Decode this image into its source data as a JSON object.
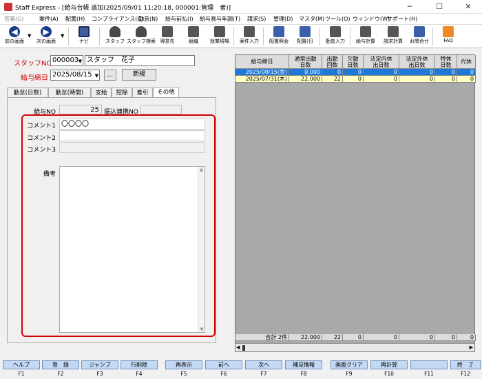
{
  "window": {
    "app_name": "Staff Express",
    "title": "Staff Express - [給与台帳 追加(2025/09/01 11:20:18, 000001:管理　者)]",
    "min": "─",
    "max": "☐",
    "close": "✕"
  },
  "menu": [
    "営業(G)",
    "案件(A)",
    "配置(H)",
    "コンプライアンス(C)",
    "勤怠(N)",
    "給与前払(I)",
    "給与賞与年調(T)",
    "請求(S)",
    "管理(D)",
    "マスタ(M)",
    "ツール(O)",
    "ウィンドウ(W)",
    "サポート(H)"
  ],
  "toolbar": [
    {
      "label": "前の画面",
      "icon": "arrow-left-icon"
    },
    {
      "label": "次の画面",
      "icon": "arrow-right-icon"
    },
    {
      "label": "ナビ",
      "icon": "monitor-icon"
    },
    {
      "label": "スタッフ",
      "icon": "staff-icon"
    },
    {
      "label": "スタッフ検索",
      "icon": "staff-search-icon"
    },
    {
      "label": "得意先",
      "icon": "client-icon"
    },
    {
      "label": "組織",
      "icon": "organization-icon"
    },
    {
      "label": "就業現場",
      "icon": "worksite-icon"
    },
    {
      "label": "案件入力",
      "icon": "case-entry-icon"
    },
    {
      "label": "配置照会",
      "icon": "assignment-inquiry-icon"
    },
    {
      "label": "配置(日",
      "icon": "assignment-daily-icon"
    },
    {
      "label": "勤怠入力",
      "icon": "attendance-entry-icon"
    },
    {
      "label": "給与計算",
      "icon": "payroll-calc-icon"
    },
    {
      "label": "請求計算",
      "icon": "billing-calc-icon"
    },
    {
      "label": "お問合せ",
      "icon": "inquiry-icon"
    },
    {
      "label": "FAQ",
      "icon": "faq-icon"
    }
  ],
  "form": {
    "staff_label": "スタッフNO",
    "staff_no": "000003",
    "staff_name": "スタッフ　花子",
    "payday_label": "給与締日",
    "payday": "2025/08/15",
    "dots": "...",
    "new_button": "新規"
  },
  "tabs": [
    "勤怠(日数)",
    "勤怠(時間)",
    "支給",
    "控除",
    "差引",
    "その他"
  ],
  "active_tab": "その他",
  "other": {
    "pay_no_label": "給与NO",
    "pay_no": "25",
    "transfer_label": "振込連携NO",
    "transfer_no": "",
    "comment1_label": "コメント1",
    "comment1": "〇〇〇〇",
    "comment2_label": "コメント2",
    "comment2": "",
    "comment3_label": "コメント3",
    "comment3": "",
    "notes_label": "備考",
    "notes": ""
  },
  "grid": {
    "headers": [
      "給与締日",
      "通常出勤\n日数",
      "出勤\n回数",
      "欠勤\n日数",
      "法定内休\n出日数",
      "法定外休\n出日数",
      "特休\n日数",
      "代休"
    ],
    "rows": [
      [
        "2025/08/15(金)",
        "0.000",
        "0",
        "0",
        "0",
        "0",
        "0",
        "0"
      ],
      [
        "2025/07/31(木)",
        "22.000",
        "22",
        "0",
        "0",
        "0",
        "0",
        "0"
      ]
    ],
    "footer": [
      "合計 2件",
      "22.000",
      "22",
      "0",
      "0",
      "0",
      "0",
      "0"
    ]
  },
  "fkeys": [
    {
      "label": "ヘルプ",
      "key": "F1"
    },
    {
      "label": "登　録",
      "key": "F2"
    },
    {
      "label": "ジャンプ",
      "key": "F3"
    },
    {
      "label": "行削除",
      "key": "F4"
    },
    {
      "label": "再表示",
      "key": "F5"
    },
    {
      "label": "前へ",
      "key": "F6"
    },
    {
      "label": "次へ",
      "key": "F7"
    },
    {
      "label": "補足情報",
      "key": "F8"
    },
    {
      "label": "画面クリア",
      "key": "F9"
    },
    {
      "label": "再計算",
      "key": "F10"
    },
    {
      "label": "",
      "key": "F11"
    },
    {
      "label": "終　了",
      "key": "F12"
    }
  ],
  "colors": {
    "accent": "#d40000",
    "selected_row": "#1e78d7",
    "yellow_row": "#ffffc0",
    "fkey": "#c3d9f3"
  }
}
